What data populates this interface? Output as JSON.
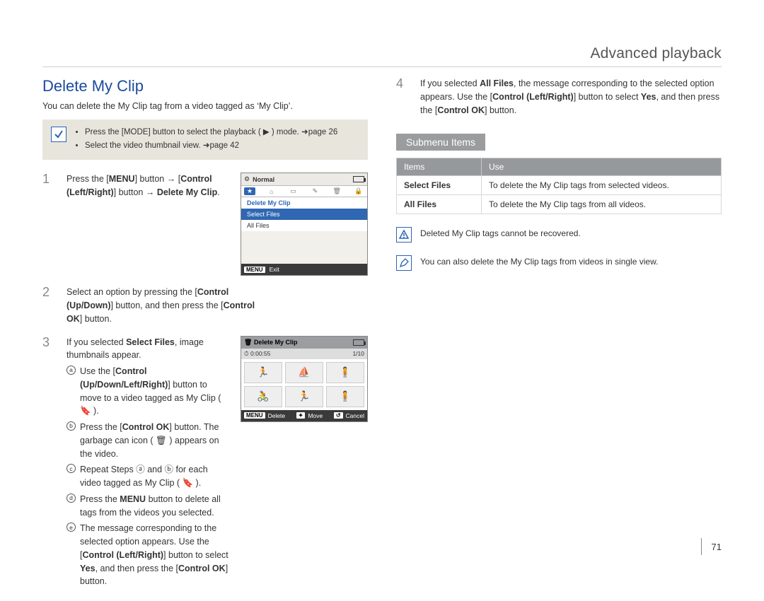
{
  "page": {
    "header": "Advanced playback",
    "number": "71"
  },
  "left": {
    "title": "Delete My Clip",
    "intro": "You can delete the My Clip tag from a video tagged as ‘My Clip’.",
    "notebox": {
      "items": [
        "Press the [MODE] button to select the playback ( ▶ ) mode. ➜page 26",
        "Select the video thumbnail view. ➜page 42"
      ]
    },
    "steps": [
      {
        "num": "1",
        "text_parts": [
          "Press the [",
          "MENU",
          "] button → [",
          "Control (Left/Right)",
          "] button → ",
          "Delete My Clip",
          "."
        ]
      },
      {
        "num": "2",
        "text_parts": [
          "Select an option by pressing the [",
          "Control (Up/Down)",
          "] button, and then press the [",
          "Control OK",
          "] button."
        ]
      },
      {
        "num": "3",
        "text_parts": [
          "If you selected ",
          "Select Files",
          ", image thumbnails appear."
        ],
        "sub": [
          {
            "label": "a",
            "parts": [
              "Use the [",
              "Control (Up/Down/Left/Right)",
              "] button to move to a video tagged as My Clip ( 🔖 )."
            ]
          },
          {
            "label": "b",
            "parts": [
              "Press the [",
              "Control OK",
              "]",
              " button. The garbage can icon ( 🗑 ) appears on the video."
            ]
          },
          {
            "label": "c",
            "parts": [
              "Repeat Steps ⓐ and ⓑ for each video tagged as My Clip ( 🔖 )."
            ]
          },
          {
            "label": "d",
            "parts": [
              "Press the ",
              "MENU",
              " button to delete all tags from the videos you selected."
            ]
          },
          {
            "label": "e",
            "parts": [
              "The message corresponding to the selected option appears. Use the [",
              "Control (Left/Right)",
              "] button to select ",
              "Yes",
              ", and then press the [",
              "Control OK",
              "] button."
            ]
          }
        ]
      }
    ],
    "lcd_menu": {
      "title": "Normal",
      "header": "Delete My Clip",
      "items": [
        "Select Files",
        "All Files"
      ],
      "bottom_tag": "MENU",
      "bottom_label": "Exit"
    },
    "lcd_thumbs": {
      "title": "Delete My Clip",
      "duration": "0:00:55",
      "counter": "1/10",
      "bot": [
        {
          "tag": "MENU",
          "label": "Delete"
        },
        {
          "tag": "✦",
          "label": "Move"
        },
        {
          "tag": "↺",
          "label": "Cancel"
        }
      ]
    }
  },
  "right": {
    "step4": {
      "num": "4",
      "parts": [
        "If you selected ",
        "All Files",
        ", the message corresponding to the selected option appears. Use the [",
        "Control (Left/Right)",
        "] button to select ",
        "Yes",
        ", and then press the [",
        "Control OK",
        "] button."
      ]
    },
    "submenu_title": "Submenu Items",
    "table": {
      "head": [
        "Items",
        "Use"
      ],
      "rows": [
        [
          "Select Files",
          "To delete the My Clip tags from selected videos."
        ],
        [
          "All Files",
          "To delete the My Clip tags from all videos."
        ]
      ]
    },
    "warn": "Deleted My Clip tags cannot be recovered.",
    "tip": "You can also delete the My Clip tags from videos in single view."
  }
}
